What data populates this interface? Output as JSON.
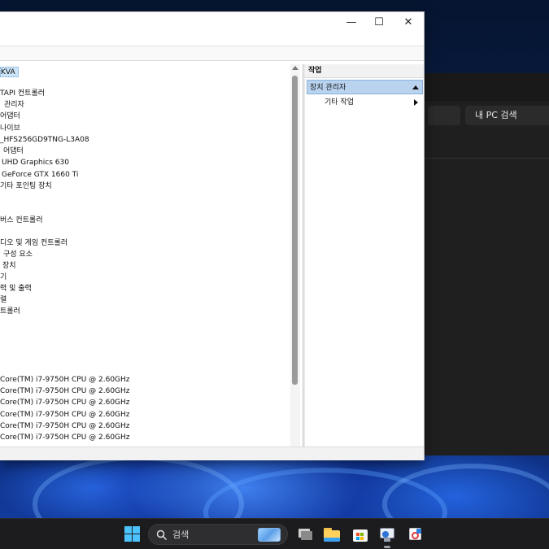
{
  "devmgr": {
    "tree_root": "KVA",
    "tree_items": [
      "TAPI 컨트롤러",
      "관리자",
      "어댑터",
      "나이브",
      "_HFS256GD9TNG-L3A08",
      "어댑터",
      "UHD Graphics 630",
      "GeForce GTX 1660 Ti",
      "기타 포인팅 장치",
      "",
      "",
      "버스 컨트롤러",
      "",
      "디오 및 게임 컨트롤러",
      "구성 요소",
      "장치",
      "기",
      "력 및 출력",
      "렬",
      "트롤러"
    ],
    "cpu_items": [
      "Core(TM) i7-9750H CPU @ 2.60GHz",
      "Core(TM) i7-9750H CPU @ 2.60GHz",
      "Core(TM) i7-9750H CPU @ 2.60GHz",
      "Core(TM) i7-9750H CPU @ 2.60GHz",
      "Core(TM) i7-9750H CPU @ 2.60GHz",
      "Core(TM) i7-9750H CPU @ 2.60GHz"
    ],
    "actions_header": "작업",
    "actions_section": "장치 관리자",
    "actions_item": "기타 작업",
    "minimize_glyph": "—",
    "maximize_glyph": "☐",
    "close_glyph": "✕"
  },
  "explorer": {
    "search_placeholder": "내 PC 검색"
  },
  "taskbar": {
    "search_label": "검색",
    "icons": [
      "windows-start-icon",
      "search-icon",
      "task-view-icon",
      "file-explorer-icon",
      "microsoft-store-icon",
      "device-manager-icon",
      "snipping-tool-icon"
    ]
  },
  "colors": {
    "accent": "#4cc2ff",
    "selection": "#cce4f7",
    "actions_section_bg": "#b9d3ef",
    "taskbar_bg": "#1c1c1e"
  }
}
